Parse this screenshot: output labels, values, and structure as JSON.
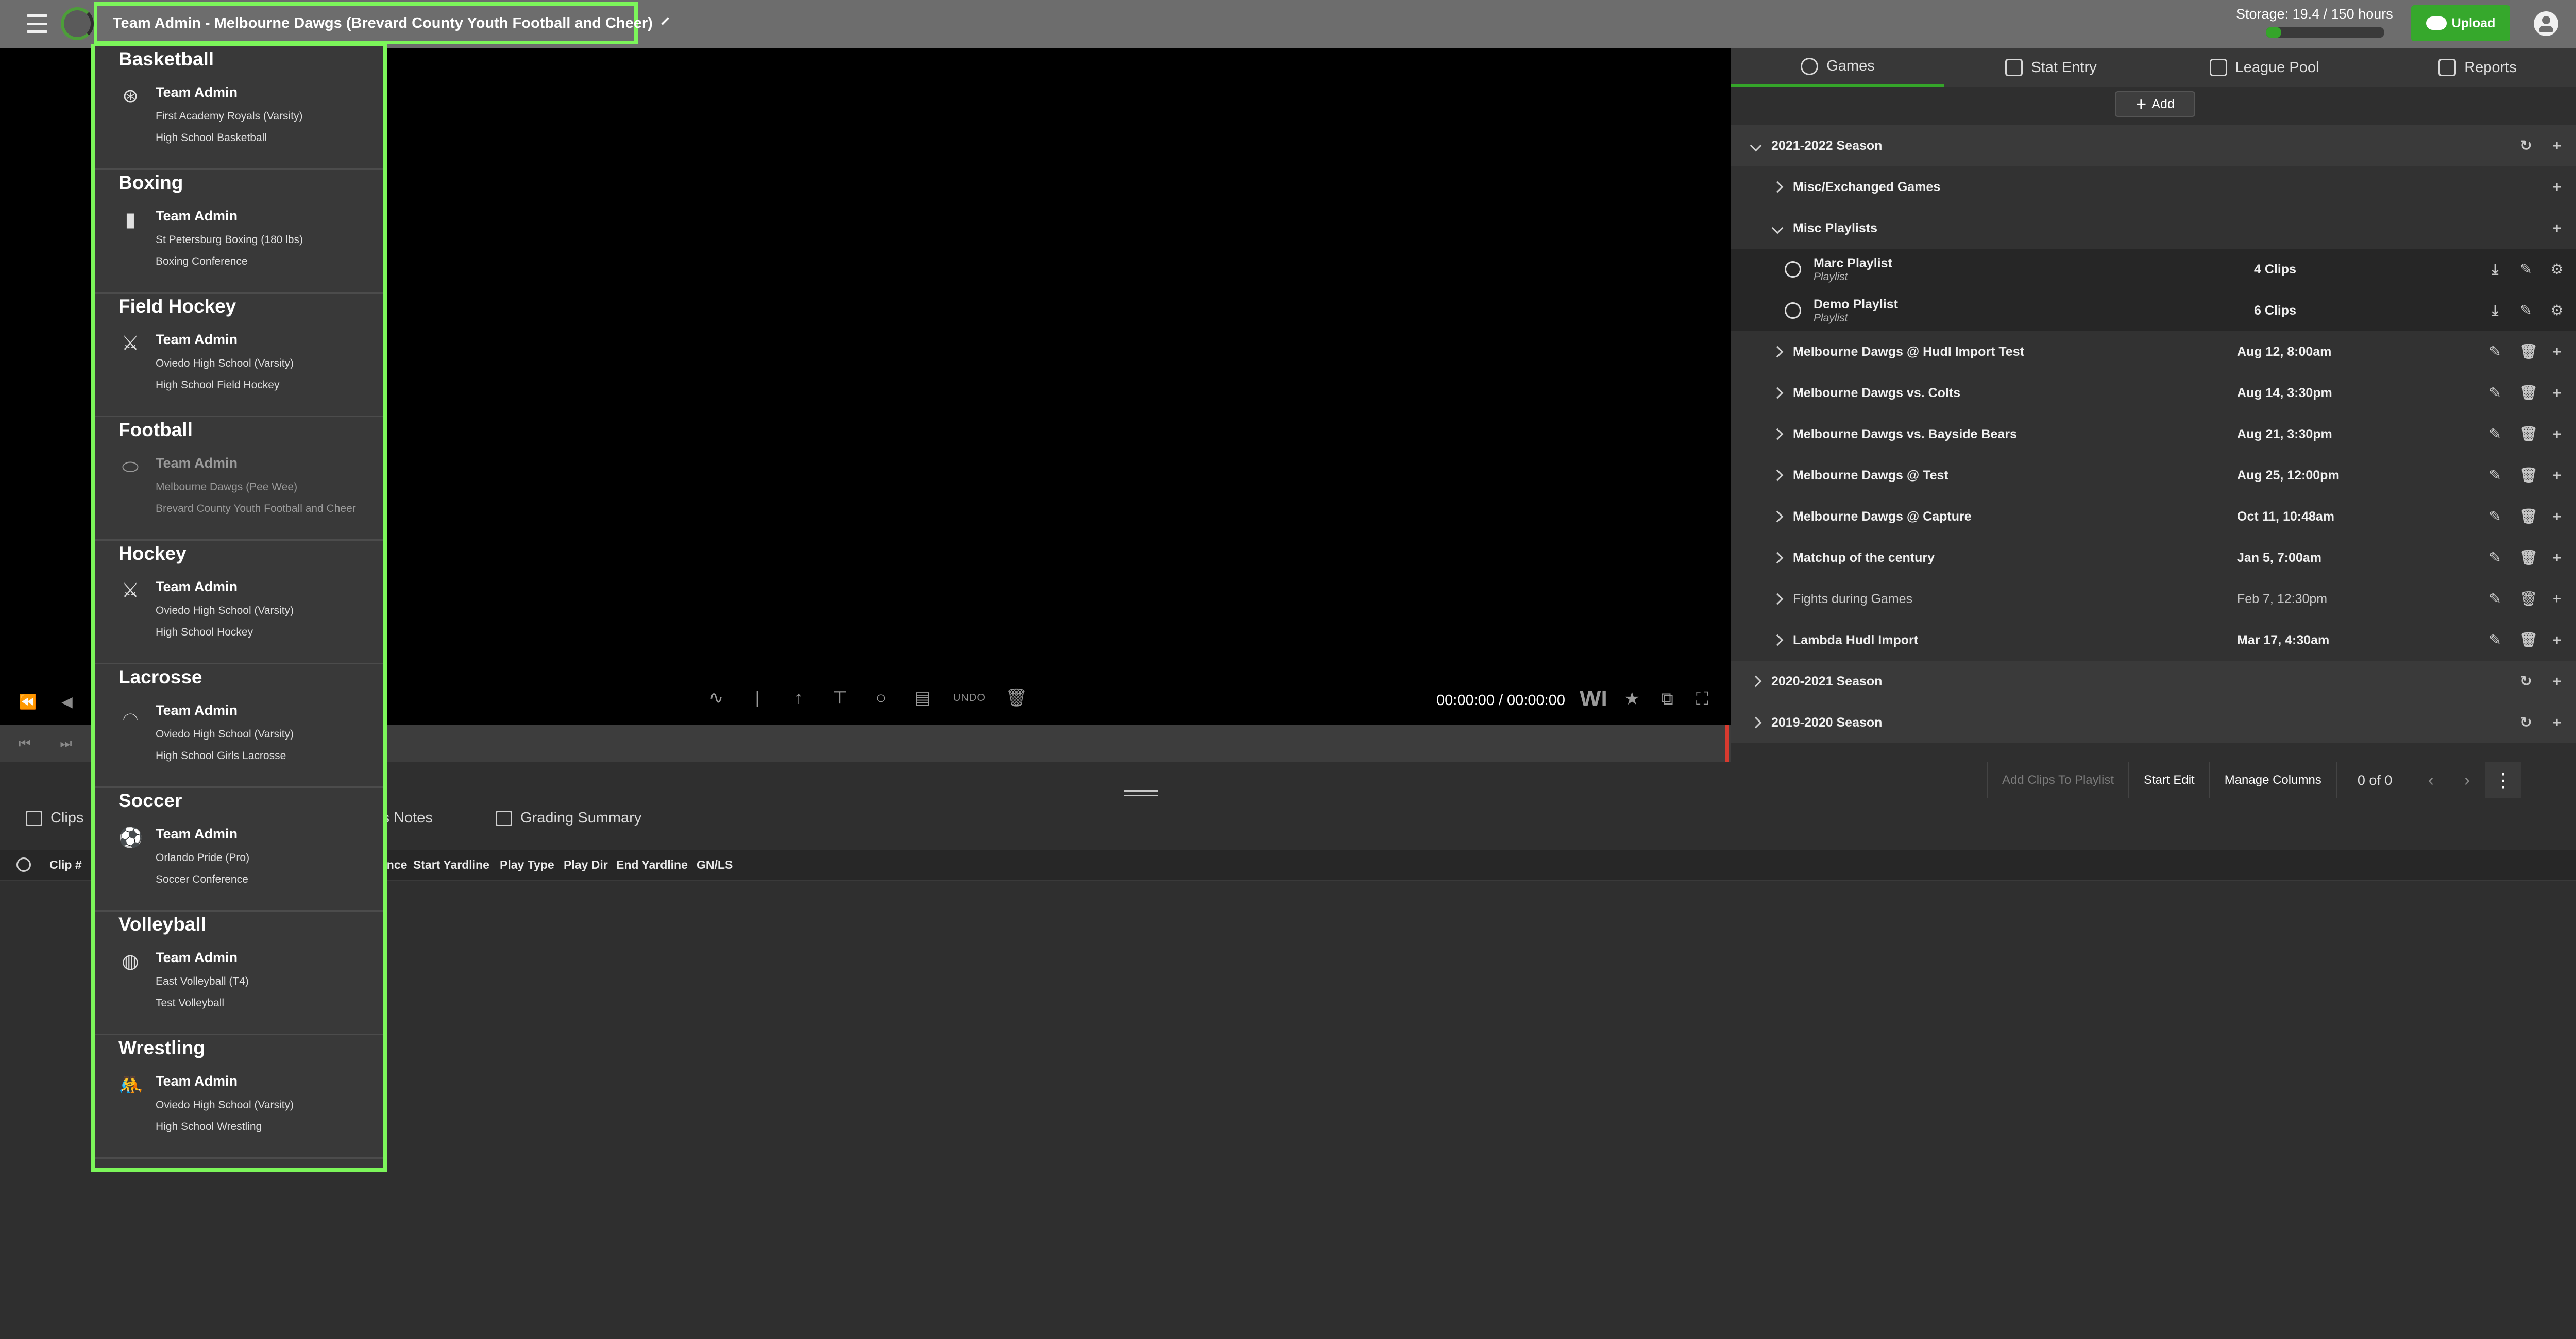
{
  "topbar": {
    "team_label": "Team Admin - Melbourne Dawgs (Brevard County Youth Football and Cheer)",
    "storage_label": "Storage: 19.4 / 150 hours",
    "storage_fraction": 0.13,
    "upload_label": "Upload",
    "accent_color": "#35a52a",
    "highlight_color": "#7cf65a"
  },
  "video": {
    "timecode": "00:00:00 / 00:00:00",
    "undo_label": "UNDO",
    "wi_label": "WI"
  },
  "right_tabs": [
    {
      "label": "Games",
      "icon": "play-circle-icon"
    },
    {
      "label": "Stat Entry",
      "icon": "keyboard-icon"
    },
    {
      "label": "League Pool",
      "icon": "video-library-icon"
    },
    {
      "label": "Reports",
      "icon": "reports-icon"
    }
  ],
  "add_label": "Add",
  "seasons": {
    "s2122": "2021-2022 Season",
    "s2021": "2020-2021 Season",
    "s1920": "2019-2020 Season"
  },
  "folders": {
    "misc_exchanged": "Misc/Exchanged Games",
    "misc_playlists": "Misc Playlists"
  },
  "playlists": [
    {
      "name": "Marc Playlist",
      "type": "Playlist",
      "clips": "4 Clips"
    },
    {
      "name": "Demo Playlist",
      "type": "Playlist",
      "clips": "6 Clips"
    }
  ],
  "games": [
    {
      "name": "Melbourne Dawgs @ Hudl Import Test",
      "date": "Aug 12, 8:00am"
    },
    {
      "name": "Melbourne Dawgs vs. Colts",
      "date": "Aug 14, 3:30pm"
    },
    {
      "name": "Melbourne Dawgs vs. Bayside Bears",
      "date": "Aug 21, 3:30pm"
    },
    {
      "name": "Melbourne Dawgs @ Test",
      "date": "Aug 25, 12:00pm"
    },
    {
      "name": "Melbourne Dawgs @ Capture",
      "date": "Oct 11, 10:48am"
    },
    {
      "name": "Matchup of the century",
      "date": "Jan 5, 7:00am"
    },
    {
      "name": "Fights during Games",
      "date": "Feb 7, 12:30pm"
    },
    {
      "name": "Lambda Hudl Import",
      "date": "Mar 17, 4:30am"
    }
  ],
  "actions": {
    "add_clips": "Add Clips To Playlist",
    "start_edit": "Start Edit",
    "manage_columns": "Manage Columns",
    "count": "0 of 0"
  },
  "bottom_tabs": {
    "clips": "Clips",
    "notes": "'s Notes",
    "grading": "Grading Summary"
  },
  "columns": {
    "clip_num": "Clip #",
    "ance": "ance",
    "start_yardline": "Start Yardline",
    "play_type": "Play Type",
    "play_dir": "Play Dir",
    "end_yardline": "End Yardline",
    "gn_ls": "GN/LS"
  },
  "dropdown": [
    {
      "sport": "Basketball",
      "role": "Team Admin",
      "team": "First Academy Royals (Varsity)",
      "league": "High School Basketball",
      "icon": "basketball-icon"
    },
    {
      "sport": "Boxing",
      "role": "Team Admin",
      "team": "St Petersburg Boxing (180 lbs)",
      "league": "Boxing Conference",
      "icon": "boxing-glove-icon"
    },
    {
      "sport": "Field Hockey",
      "role": "Team Admin",
      "team": "Oviedo High School (Varsity)",
      "league": "High School Field Hockey",
      "icon": "field-hockey-icon"
    },
    {
      "sport": "Football",
      "role": "Team Admin",
      "team": "Melbourne Dawgs (Pee Wee)",
      "league": "Brevard County Youth Football and Cheer",
      "icon": "football-icon"
    },
    {
      "sport": "Hockey",
      "role": "Team Admin",
      "team": "Oviedo High School (Varsity)",
      "league": "High School Hockey",
      "icon": "hockey-icon"
    },
    {
      "sport": "Lacrosse",
      "role": "Team Admin",
      "team": "Oviedo High School (Varsity)",
      "league": "High School Girls Lacrosse",
      "icon": "lacrosse-icon"
    },
    {
      "sport": "Soccer",
      "role": "Team Admin",
      "team": "Orlando Pride (Pro)",
      "league": "Soccer Conference",
      "icon": "soccer-ball-icon"
    },
    {
      "sport": "Volleyball",
      "role": "Team Admin",
      "team": "East Volleyball (T4)",
      "league": "Test Volleyball",
      "icon": "volleyball-icon"
    },
    {
      "sport": "Wrestling",
      "role": "Team Admin",
      "team": "Oviedo High School (Varsity)",
      "league": "High School Wrestling",
      "icon": "wrestling-icon"
    }
  ]
}
